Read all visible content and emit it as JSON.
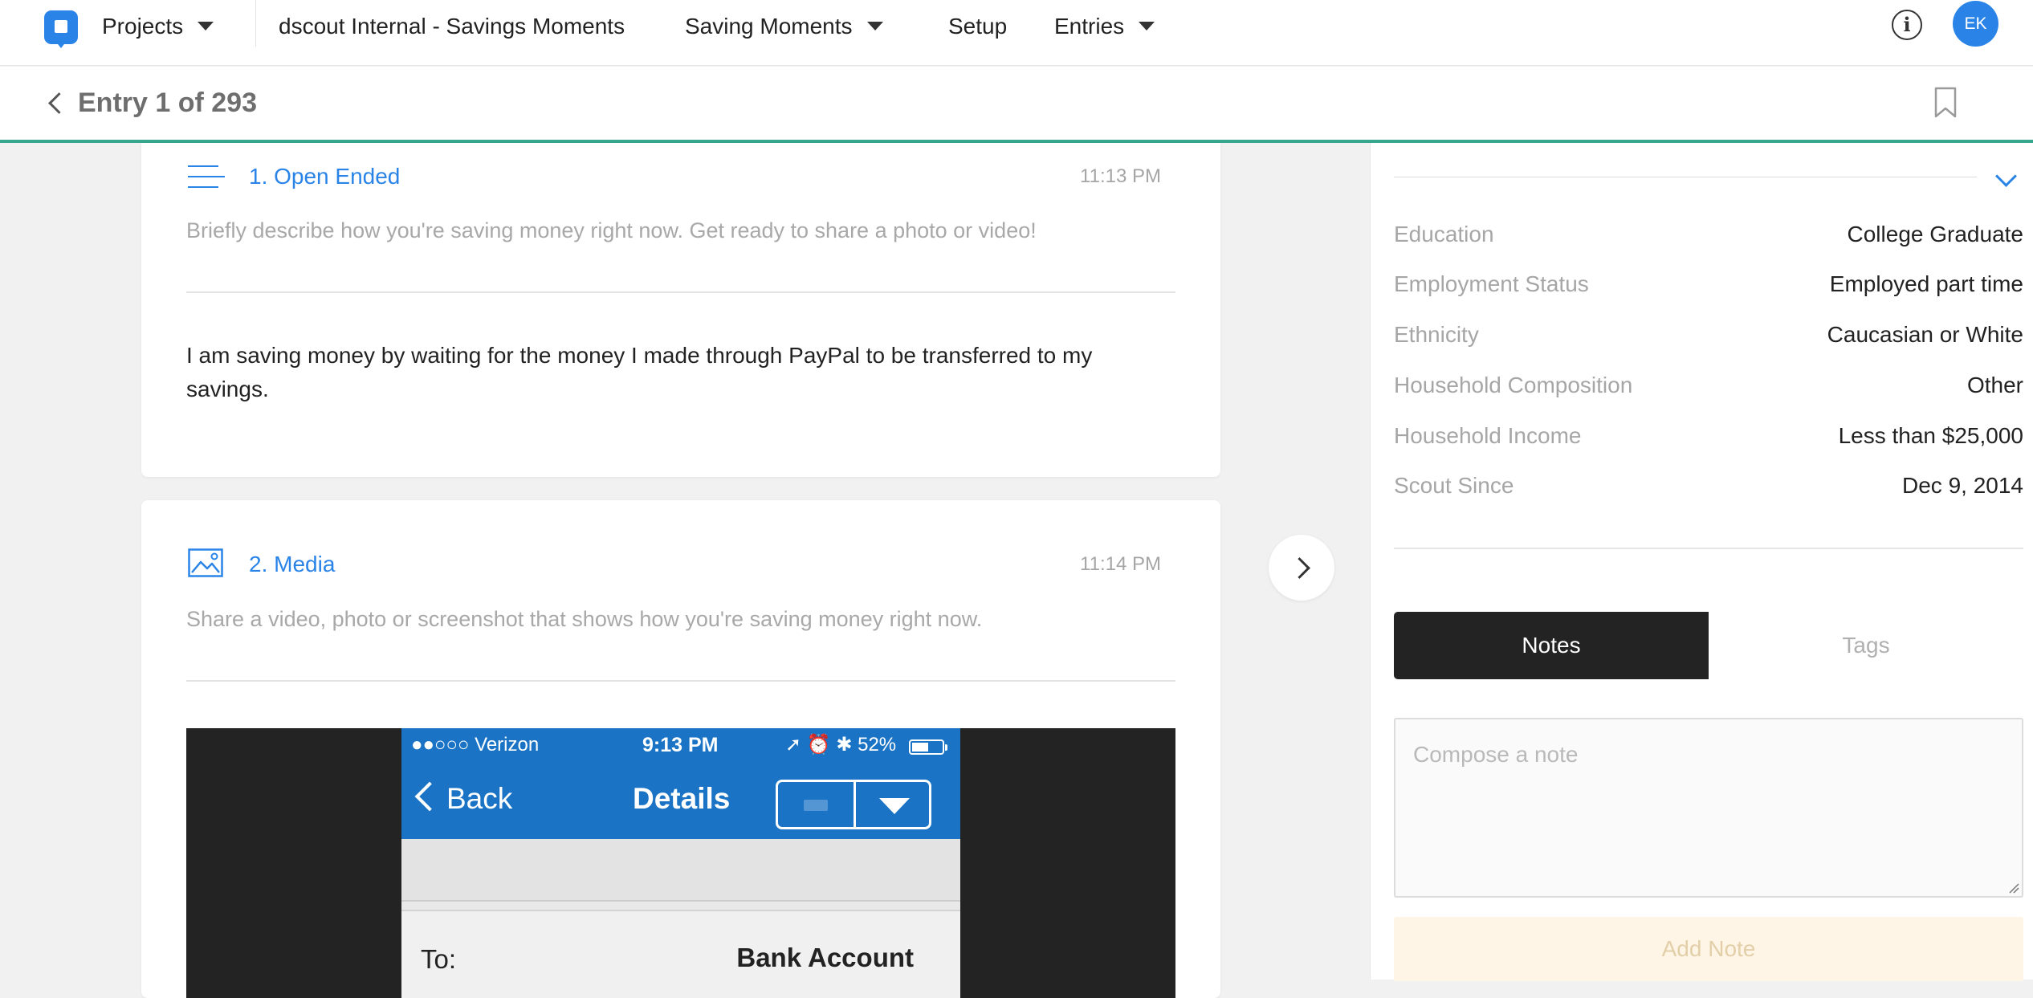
{
  "nav": {
    "projects_label": "Projects",
    "project_name": "dscout Internal - Savings Moments",
    "mission_label": "Saving Moments",
    "setup_label": "Setup",
    "entries_label": "Entries",
    "info_symbol": "i",
    "avatar_initials": "EK"
  },
  "subheader": {
    "entry_title": "Entry 1 of 293"
  },
  "questions": [
    {
      "title": "1. Open Ended",
      "time": "11:13 PM",
      "prompt": "Briefly describe how you're saving money right now. Get ready to share a photo or video!",
      "answer": "I am saving money by waiting for the money I made through PayPal to be transferred to my savings.",
      "icon": "text-lines-icon"
    },
    {
      "title": "2. Media",
      "time": "11:14 PM",
      "prompt": "Share a video, photo or screenshot that shows how you're saving money right now.",
      "icon": "image-icon",
      "media": {
        "status_left": "●●○○○ Verizon",
        "status_time": "9:13 PM",
        "status_right": "➚ ⏰ ✱ 52%",
        "nav_back": "Back",
        "nav_title": "Details",
        "row_label": "To:",
        "row_value": "Bank Account"
      }
    }
  ],
  "profile": {
    "attributes": [
      {
        "label": "Education",
        "value": "College Graduate"
      },
      {
        "label": "Employment Status",
        "value": "Employed part time"
      },
      {
        "label": "Ethnicity",
        "value": "Caucasian or White"
      },
      {
        "label": "Household Composition",
        "value": "Other"
      },
      {
        "label": "Household Income",
        "value": "Less than $25,000"
      },
      {
        "label": "Scout Since",
        "value": "Dec 9, 2014"
      }
    ]
  },
  "tabs": {
    "notes": "Notes",
    "tags": "Tags"
  },
  "notes": {
    "placeholder": "Compose a note",
    "add_button": "Add Note"
  },
  "colors": {
    "accent": "#2a84e8",
    "header_underline": "#36a68c",
    "active_tab": "#232323"
  }
}
